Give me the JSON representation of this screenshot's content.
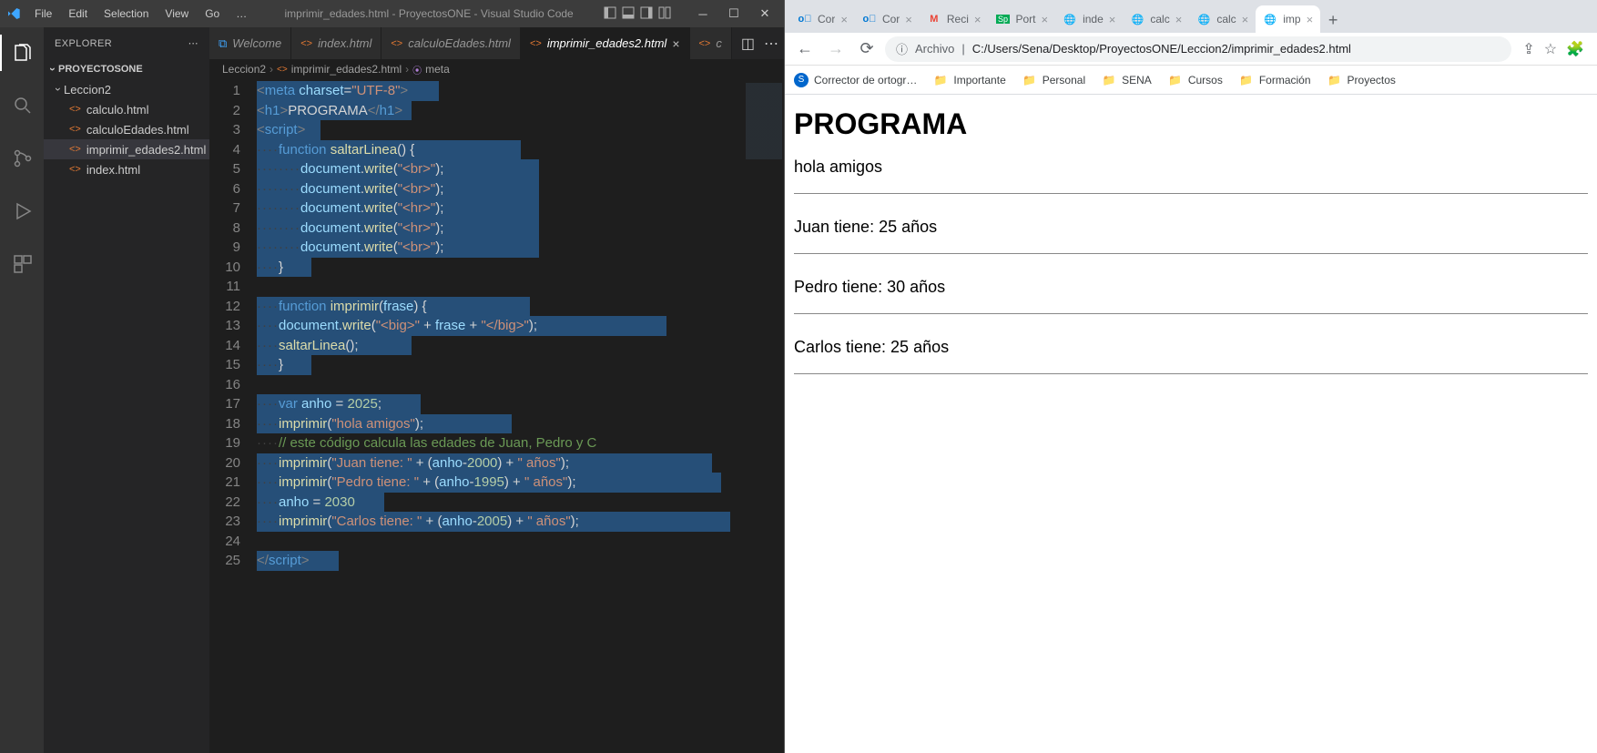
{
  "vscode": {
    "menus": [
      "File",
      "Edit",
      "Selection",
      "View",
      "Go",
      "…"
    ],
    "title": "imprimir_edades.html - ProyectosONE - Visual Studio Code",
    "explorer": {
      "header": "EXPLORER",
      "project": "PROYECTOSONE",
      "folder": "Leccion2",
      "files": [
        "calculo.html",
        "calculoEdades.html",
        "imprimir_edades2.html",
        "index.html"
      ],
      "selected": "imprimir_edades2.html"
    },
    "tabs": [
      {
        "label": "Welcome",
        "type": "welcome"
      },
      {
        "label": "index.html",
        "type": "html"
      },
      {
        "label": "calculoEdades.html",
        "type": "html"
      },
      {
        "label": "imprimir_edades2.html",
        "type": "html",
        "active": true
      },
      {
        "label": "c",
        "type": "html"
      }
    ],
    "breadcrumb": {
      "folder": "Leccion2",
      "file": "imprimir_edades2.html",
      "symbol": "meta"
    },
    "code": {
      "line_count": 25
    }
  },
  "browser": {
    "tabs": [
      {
        "fav": "outlook",
        "label": "Cor",
        "active": false
      },
      {
        "fav": "outlook",
        "label": "Cor",
        "active": false
      },
      {
        "fav": "gmail",
        "label": "Reci",
        "active": false
      },
      {
        "fav": "sp",
        "label": "Port",
        "active": false
      },
      {
        "fav": "globe",
        "label": "inde",
        "active": false
      },
      {
        "fav": "globe",
        "label": "calc",
        "active": false
      },
      {
        "fav": "globe",
        "label": "calc",
        "active": false
      },
      {
        "fav": "globe",
        "label": "imp",
        "active": true
      }
    ],
    "url_label": "Archivo",
    "url": "C:/Users/Sena/Desktop/ProyectosONE/Leccion2/imprimir_edades2.html",
    "bookmarks": [
      {
        "icon": "s",
        "label": "Corrector de ortogr…"
      },
      {
        "icon": "f",
        "label": "Importante"
      },
      {
        "icon": "f",
        "label": "Personal"
      },
      {
        "icon": "f",
        "label": "SENA"
      },
      {
        "icon": "f",
        "label": "Cursos"
      },
      {
        "icon": "f",
        "label": "Formación"
      },
      {
        "icon": "f",
        "label": "Proyectos"
      }
    ],
    "page": {
      "title": "PROGRAMA",
      "lines": [
        "hola amigos",
        "Juan tiene: 25 años",
        "Pedro tiene: 30 años",
        "Carlos tiene: 25 años"
      ]
    }
  }
}
